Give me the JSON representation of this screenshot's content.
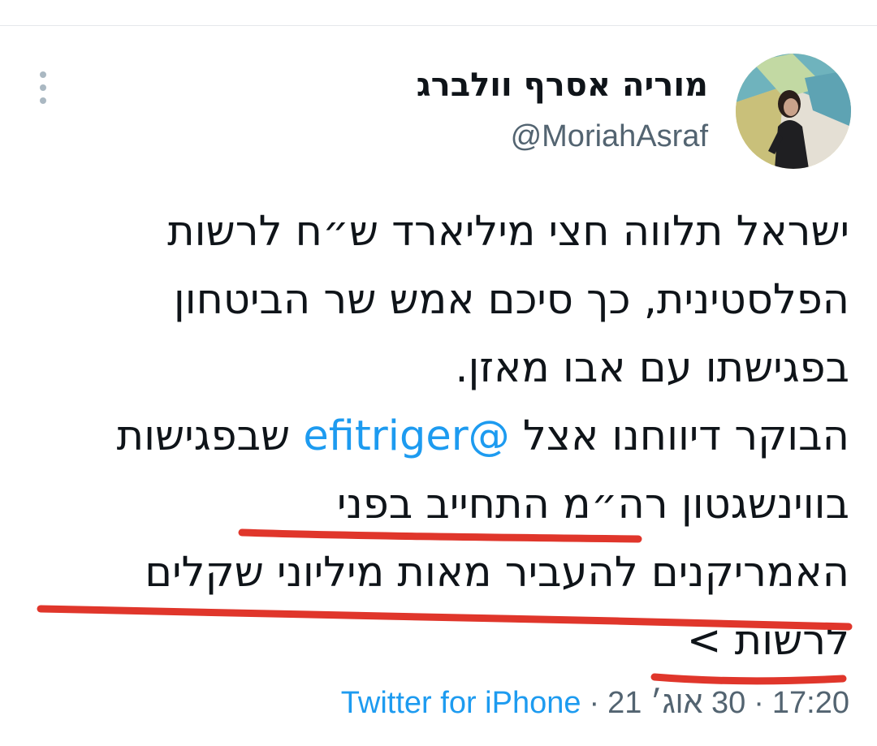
{
  "tweet": {
    "author": {
      "display_name": "מוריה אסרף וולברג",
      "handle": "@MoriahAsraf"
    },
    "body": {
      "line1": "ישראל תלווה חצי מיליארד ש״ח לרשות",
      "line2": "הפלסטינית, כך סיכם אמש שר הביטחון",
      "line3": "בפגישתו עם אבו מאזן.",
      "line4_before": "הבוקר דיווחנו אצל",
      "line4_mention": "@efitriger",
      "line4_after": "שבפגישות",
      "line5": "בווינשגטון רה״מ התחייב בפני",
      "line6": "האמריקנים להעביר מאות מיליוני שקלים",
      "line7": "לרשות",
      "show_more": ">"
    },
    "meta": {
      "time": "17:20",
      "date": "30 אוג׳ 21",
      "separator": "·",
      "source": "Twitter for iPhone"
    }
  },
  "icons": {
    "more": "more-vertical-icon",
    "avatar": "profile-photo"
  },
  "colors": {
    "text": "#0f1419",
    "secondary": "#536471",
    "link": "#1d9bf0",
    "annotation": "#e0362b",
    "divider": "#e5e8eb"
  }
}
